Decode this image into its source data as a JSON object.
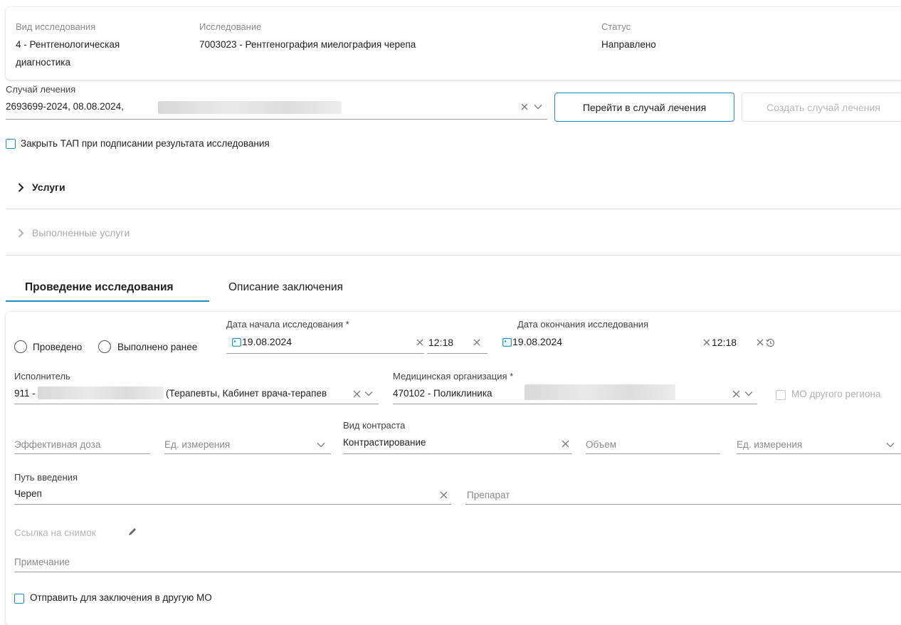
{
  "study_card": {
    "type_label": "Вид исследования",
    "type_value_line1": "4 - Рентгенологическая",
    "type_value_line2": "диагностика",
    "study_label": "Исследование",
    "study_value": "7003023 - Рентгенография миелография черепа",
    "status_label": "Статус",
    "status_value": "Направлено"
  },
  "treatment_case": {
    "label": "Случай лечения",
    "value": "2693699-2024, 08.08.2024,",
    "goto_button": "Перейти в случай лечения",
    "create_button": "Создать случай лечения"
  },
  "close_tap_checkbox": {
    "label": "Закрыть ТАП при подписании результата исследования",
    "checked": false
  },
  "sections": {
    "services": "Услуги",
    "performed_services": "Выполненные услуги"
  },
  "tabs": [
    {
      "label": "Проведение исследования",
      "active": true
    },
    {
      "label": "Описание заключения",
      "active": false
    }
  ],
  "form": {
    "radio_done": "Проведено",
    "radio_done_earlier": "Выполнено ранее",
    "start_date_label": "Дата начала исследования *",
    "start_date": "19.08.2024",
    "start_time": "12:18",
    "end_date_label": "Дата окончания исследования",
    "end_date": "19.08.2024",
    "end_time": "12:18",
    "executor_label": "Исполнитель",
    "executor_prefix": "911 -",
    "executor_suffix": "(Терапевты, Кабинет врача-терапев",
    "mo_label": "Медицинская организация *",
    "mo_value": "470102 - Поликлиника",
    "other_region_label": "МО другого региона",
    "effective_dose_placeholder": "Эффективная доза",
    "unit_placeholder_1": "Ед. измерения",
    "contrast_label": "Вид контраста",
    "contrast_value": "Контрастирование",
    "volume_placeholder": "Объем",
    "unit_placeholder_2": "Ед. измерения",
    "route_label": "Путь введения",
    "route_value": "Череп",
    "drug_placeholder": "Препарат",
    "image_link_label": "Ссылка на снимок",
    "note_placeholder": "Примечание",
    "send_other_mo_label": "Отправить для заключения в другую МО"
  },
  "colors": {
    "accent": "#1a8ecb",
    "tab_underline": "#1a8ecb"
  },
  "icons": {
    "clear": "close-icon",
    "dropdown": "chevron-down-icon",
    "calendar": "calendar-icon",
    "expand": "chevron-right-icon",
    "edit": "pencil-icon",
    "time_reset": "history-icon"
  }
}
